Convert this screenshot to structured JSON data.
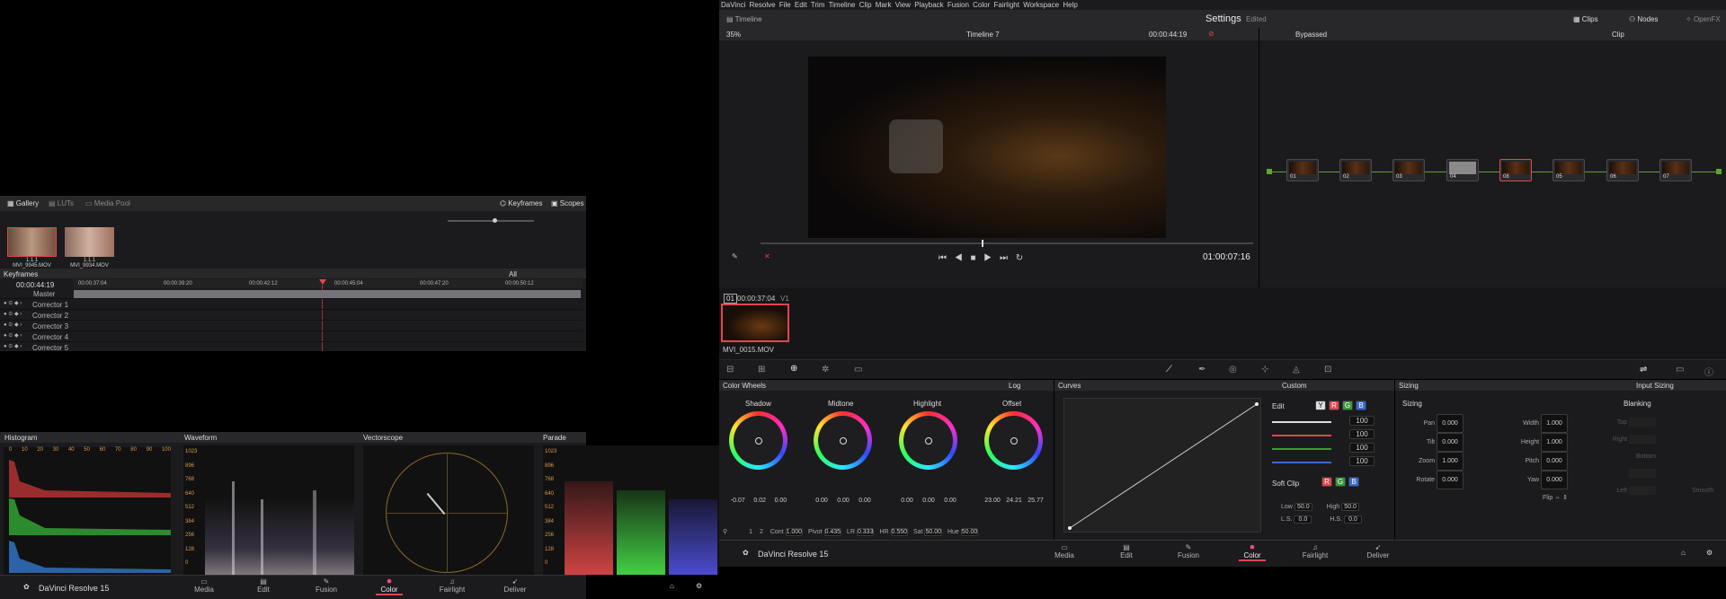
{
  "app": "DaVinci Resolve 15",
  "menu": [
    "DaVinci Resolve",
    "File",
    "Edit",
    "Trim",
    "Timeline",
    "Clip",
    "Mark",
    "View",
    "Playback",
    "Fusion",
    "Color",
    "Fairlight",
    "Workspace",
    "Help"
  ],
  "topbar": {
    "timeline": "Timeline",
    "title": "Settings",
    "status": "Edited",
    "clips": "Clips",
    "nodes": "Nodes",
    "openfx": "OpenFX"
  },
  "viewer": {
    "zoom": "35%",
    "timeline_name": "Timeline 7",
    "timecode": "00:00:44:19",
    "timecode_big": "01:00:07:16"
  },
  "node_editor": {
    "label": "Bypassed",
    "mode": "Clip",
    "nodes": [
      "01",
      "02",
      "03",
      "04",
      "08",
      "05",
      "06",
      "07"
    ]
  },
  "clip": {
    "num": "01",
    "tc": "00:00:37:04",
    "track": "V1",
    "name": "MVI_0015.MOV"
  },
  "gallery": {
    "tabs": [
      "Gallery",
      "LUTs",
      "Media Pool"
    ],
    "right": [
      "Keyframes",
      "Scopes"
    ],
    "stills": [
      {
        "num": "1.1.1",
        "name": "MVI_9945.MOV"
      },
      {
        "num": "1.1.1",
        "name": "MVI_9934.MOV"
      }
    ]
  },
  "keyframes": {
    "title": "Keyframes",
    "filter": "All",
    "tc": "00:00:44:19",
    "ruler": [
      "00:00:37:04",
      "00:00:39:20",
      "00:00:42:12",
      "00:00:45:04",
      "00:00:47:20",
      "00:00:50:12"
    ],
    "tracks": [
      "Master",
      "Corrector 1",
      "Corrector 2",
      "Corrector 3",
      "Corrector 4",
      "Corrector 5"
    ]
  },
  "scopes": {
    "histogram": "Histogram",
    "waveform": "Waveform",
    "vectorscope": "Vectorscope",
    "parade": "Parade",
    "hist_ticks": [
      "0",
      "10",
      "20",
      "30",
      "40",
      "50",
      "60",
      "70",
      "80",
      "90",
      "100"
    ],
    "levels": [
      "1023",
      "896",
      "768",
      "640",
      "512",
      "384",
      "256",
      "128",
      "0"
    ]
  },
  "color_wheels": {
    "title": "Color Wheels",
    "mode": "Log",
    "wheels": [
      {
        "name": "Shadow",
        "vals": [
          "-0.07",
          "0.02",
          "0.00"
        ]
      },
      {
        "name": "Midtone",
        "vals": [
          "0.00",
          "0.00",
          "0.00"
        ]
      },
      {
        "name": "Highlight",
        "vals": [
          "0.00",
          "0.00",
          "0.00"
        ]
      },
      {
        "name": "Offset",
        "vals": [
          "23.00",
          "24.21",
          "25.77"
        ]
      }
    ],
    "rgb": [
      "R",
      "G",
      "B"
    ],
    "page": [
      "1",
      "2"
    ],
    "params": [
      {
        "k": "Cont",
        "v": "1.000"
      },
      {
        "k": "Pivot",
        "v": "0.435"
      },
      {
        "k": "LR",
        "v": "0.333"
      },
      {
        "k": "HR",
        "v": "0.550"
      },
      {
        "k": "Sat",
        "v": "50.00"
      },
      {
        "k": "Hue",
        "v": "50.00"
      }
    ]
  },
  "curves": {
    "title": "Curves",
    "mode": "Custom",
    "edit": "Edit",
    "channels": [
      "Y",
      "R",
      "G",
      "B"
    ],
    "values": [
      "100",
      "100",
      "100",
      "100"
    ],
    "softclip": "Soft Clip",
    "low": "Low",
    "low_v": "50.0",
    "high": "High",
    "high_v": "50.0",
    "ls": "L.S.",
    "ls_v": "0.0",
    "hs": "H.S.",
    "hs_v": "0.0"
  },
  "sizing": {
    "title": "Sizing",
    "mode": "Input Sizing",
    "section": "Sizing",
    "blanking": "Blanking",
    "left": [
      {
        "k": "Pan",
        "v": "0.000"
      },
      {
        "k": "Tilt",
        "v": "0.000"
      },
      {
        "k": "Zoom",
        "v": "1.000"
      },
      {
        "k": "Rotate",
        "v": "0.000"
      }
    ],
    "right": [
      {
        "k": "Width",
        "v": "1.000"
      },
      {
        "k": "Height",
        "v": "1.000"
      },
      {
        "k": "Pitch",
        "v": "0.000"
      },
      {
        "k": "Yaw",
        "v": "0.000"
      },
      {
        "k": "Flip",
        "v": ""
      }
    ],
    "blank": [
      "Top",
      "Right",
      "Bottom",
      "Left",
      "Smooth"
    ]
  },
  "pages": [
    "Media",
    "Edit",
    "Fusion",
    "Color",
    "Fairlight",
    "Deliver"
  ],
  "active_page": "Color",
  "colors": {
    "accent": "#e0474c",
    "bg": "#1b1b1e"
  }
}
